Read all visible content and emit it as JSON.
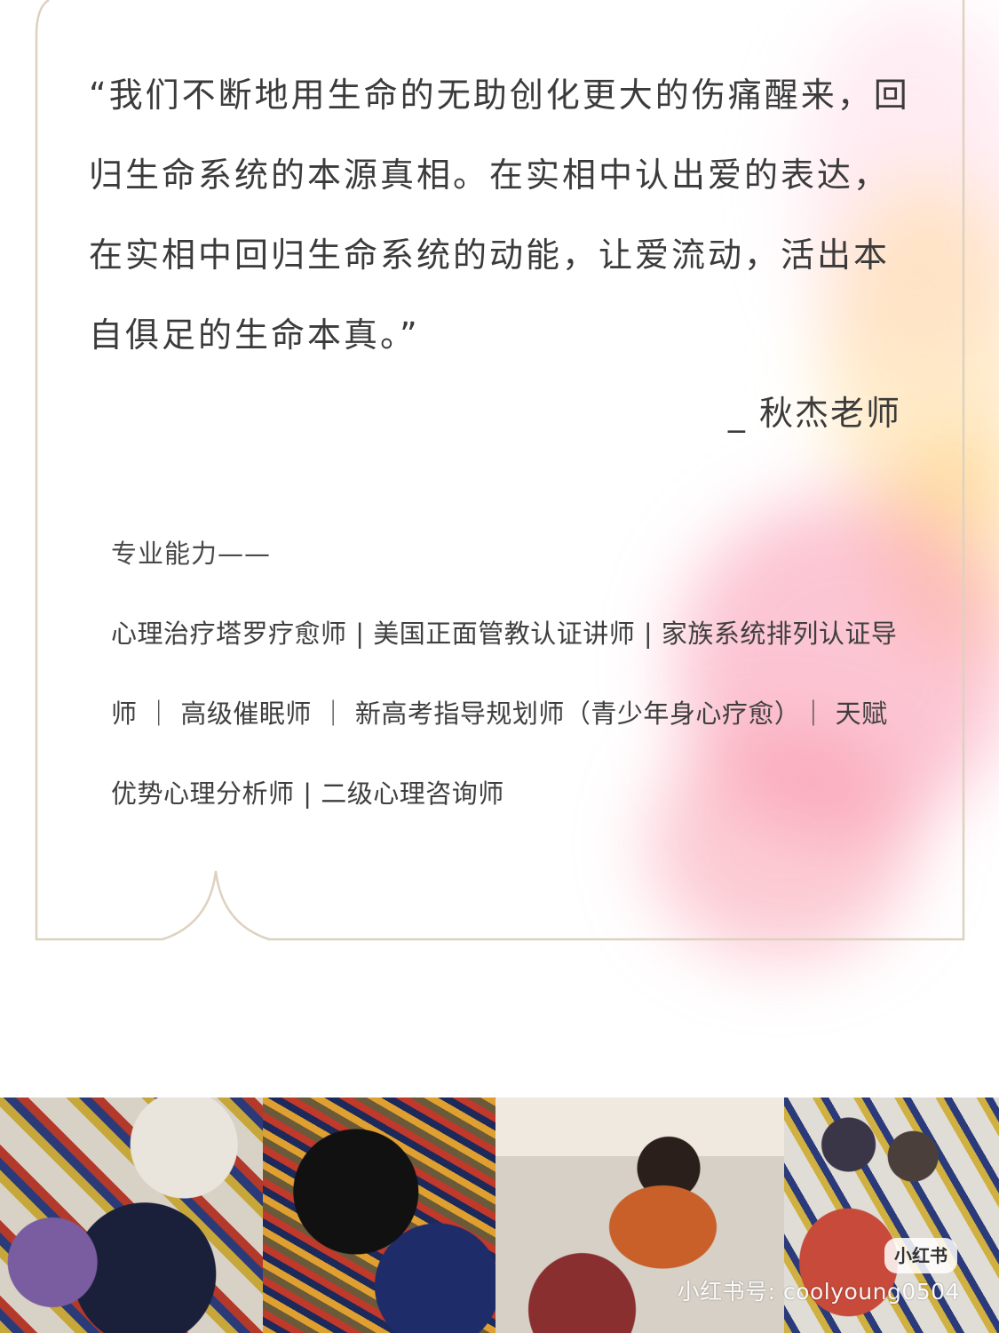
{
  "quote": {
    "text": "“我们不断地用生命的无助创化更大的伤痛醒来，回归生命系统的本源真相。在实相中认出爱的表达，在实相中回归生命系统的动能，让爱流动，活出本自俱足的生命本真。”",
    "author": "_ 秋杰老师"
  },
  "abilities": {
    "heading": "专业能力——",
    "text": "心理治疗塔罗疗愈师 | 美国正面管教认证讲师 | 家族系统排列认证导师 ｜ 高级催眠师 ｜ 新高考指导规划师（青少年身心疗愈）｜ 天赋优势心理分析师 | 二级心理咨询师"
  },
  "watermark": {
    "badge": "小红书",
    "text": "小红书号: coolyoung0504"
  }
}
